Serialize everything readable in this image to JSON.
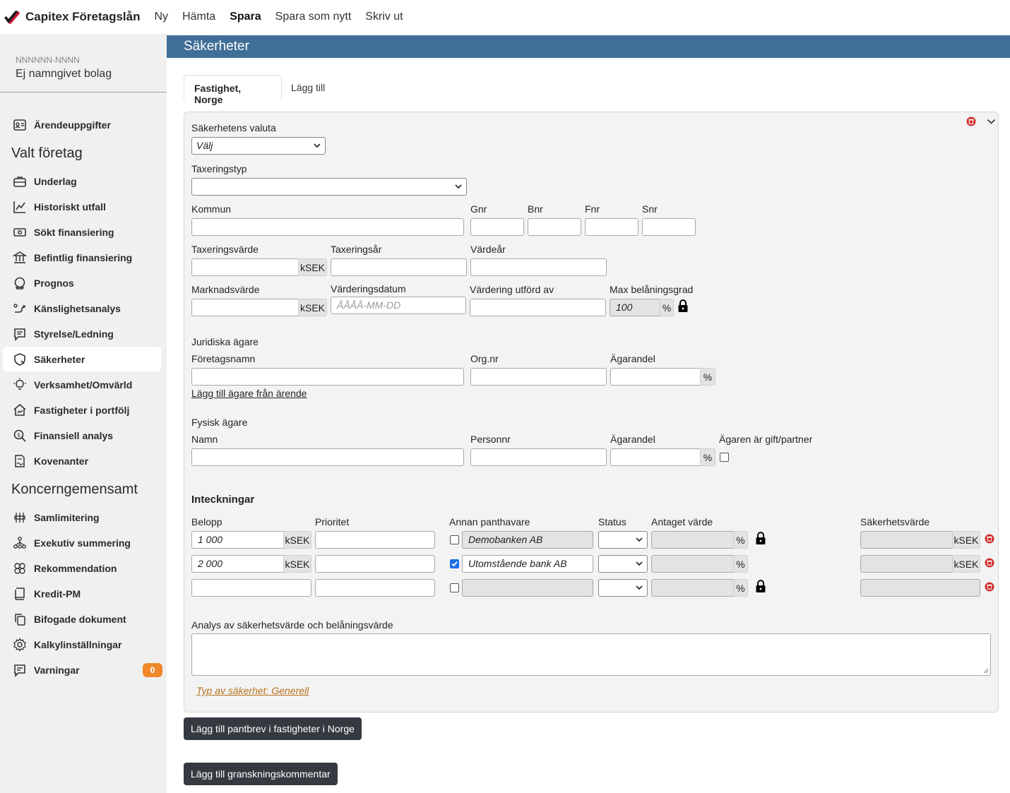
{
  "app": {
    "brand": "Capitex Företagslån",
    "menu": [
      "Ny",
      "Hämta",
      "Spara",
      "Spara som nytt",
      "Skriv ut"
    ]
  },
  "company": {
    "orgnr": "NNNNNN-NNNN",
    "name": "Ej namngivet bolag"
  },
  "sidebar": {
    "top_item": "Ärendeuppgifter",
    "group1_title": "Valt företag",
    "group1": [
      "Underlag",
      "Historiskt utfall",
      "Sökt finansiering",
      "Befintlig finansiering",
      "Prognos",
      "Känslighetsanalys",
      "Styrelse/Ledning",
      "Säkerheter",
      "Verksamhet/Omvärld",
      "Fastigheter i portfölj",
      "Finansiell analys",
      "Kovenanter"
    ],
    "group2_title": "Koncerngemensamt",
    "group2": [
      "Samlimitering",
      "Exekutiv summering",
      "Rekommendation",
      "Kredit-PM",
      "Bifogade dokument",
      "Kalkylinställningar",
      "Varningar"
    ],
    "warnings_count": "0"
  },
  "page": {
    "title": "Säkerheter"
  },
  "tabs": {
    "active": "Fastighet, Norge",
    "add": "Lägg till"
  },
  "form": {
    "currency_label": "Säkerhetens valuta",
    "currency_value": "Välj",
    "tax_type_label": "Taxeringstyp",
    "tax_type_value": "",
    "kommun_label": "Kommun",
    "gnr_label": "Gnr",
    "bnr_label": "Bnr",
    "fnr_label": "Fnr",
    "snr_label": "Snr",
    "tax_value_label": "Taxeringsvärde",
    "tax_year_label": "Taxeringsår",
    "value_year_label": "Värdeår",
    "market_value_label": "Marknadsvärde",
    "valuation_date_label": "Värderingsdatum",
    "valuation_date_placeholder": "ÅÅÅÅ-MM-DD",
    "valued_by_label": "Värdering utförd av",
    "max_ltv_label": "Max belåningsgrad",
    "max_ltv_value": "100",
    "unit_ksek": "kSEK",
    "unit_pct": "%"
  },
  "legal_owners": {
    "title": "Juridiska ägare",
    "company_label": "Företagsnamn",
    "orgnr_label": "Org.nr",
    "share_label": "Ägarandel",
    "add_link": "Lägg till ägare från ärende"
  },
  "physical_owners": {
    "title": "Fysisk ägare",
    "name_label": "Namn",
    "personnr_label": "Personnr",
    "share_label": "Ägarandel",
    "married_label": "Ägaren är gift/partner"
  },
  "mortgages": {
    "title": "Inteckningar",
    "col_amount": "Belopp",
    "col_priority": "Prioritet",
    "col_other_holder": "Annan panthavare",
    "col_status": "Status",
    "col_assumed": "Antaget värde",
    "col_security_value": "Säkerhetsvärde",
    "rows": [
      {
        "amount": "1 000",
        "unit": "kSEK",
        "priority": "",
        "other_checked": false,
        "holder": "Demobanken AB",
        "pct": "%",
        "sec_unit": "kSEK"
      },
      {
        "amount": "2 000",
        "unit": "kSEK",
        "priority": "",
        "other_checked": true,
        "holder": "Utomstående bank AB",
        "pct": "%",
        "sec_unit": "kSEK"
      },
      {
        "amount": "",
        "unit": "",
        "priority": "",
        "other_checked": false,
        "holder": "",
        "pct": "%",
        "sec_unit": ""
      }
    ]
  },
  "analysis": {
    "label": "Analys av säkerhetsvärde och belåningsvärde",
    "type_link": "Typ av säkerhet: Generell"
  },
  "buttons": {
    "add_pledge": "Lägg till pantbrev i fastigheter i Norge",
    "add_review": "Lägg till granskningskommentar"
  },
  "colors": {
    "header": "#3f6e96",
    "sidebar": "#f0f0f0",
    "badge": "#f0892b",
    "brand_red": "#c8102e",
    "dark_button": "#343a40"
  }
}
